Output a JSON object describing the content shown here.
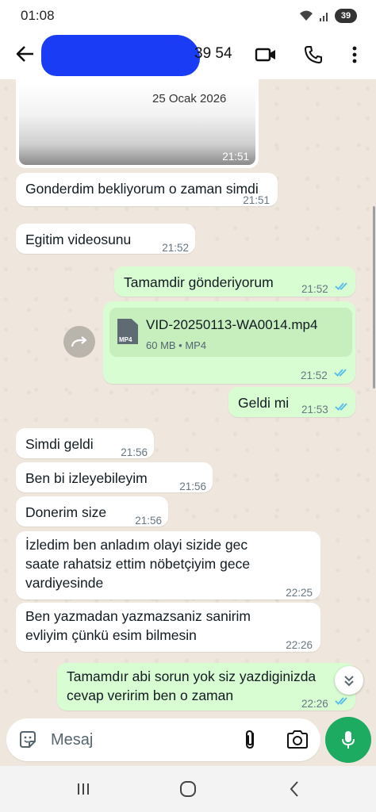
{
  "status_bar": {
    "time": "01:08",
    "battery": "39"
  },
  "header": {
    "contact_name_visible": "39 54"
  },
  "messages": [
    {
      "text": "Gonderdim bekliyorum o zaman simdi",
      "time": "21:51"
    },
    {
      "text": "Egitim videosunu",
      "time": "21:52"
    },
    {
      "text": "Tamamdir gönderiyorum",
      "time": "21:52"
    },
    {
      "time": "21:52"
    },
    {
      "text": "Geldi mi",
      "time": "21:53"
    },
    {
      "text": "Simdi geldi",
      "time": "21:56"
    },
    {
      "text": "Ben bi izleyebileyim",
      "time": "21:56"
    },
    {
      "text": "Donerim size",
      "time": "21:56"
    },
    {
      "line1": "İzledim ben anladım olayi sizide gec",
      "line2": "saate rahatsiz ettim nöbetçiyim gece",
      "line3": "vardiyesinde",
      "time": "22:25"
    },
    {
      "line1": "Ben yazmadan yazmazsaniz sanirim",
      "line2": "evliyim çünkü esim bilmesin",
      "time": "22:26"
    },
    {
      "line1": "Tamamdır abi sorun yok siz yazdiginizda",
      "line2": "cevap veririm ben o zaman",
      "time": "22:26"
    }
  ],
  "image_message": {
    "date_in_image": "25 Ocak 2026",
    "time": "21:51"
  },
  "file": {
    "name": "VID-20250113-WA0014.mp4",
    "meta": "60 MB • MP4",
    "type_label": "MP4"
  },
  "composer": {
    "placeholder": "Mesaj"
  },
  "colors": {
    "incoming": "#ffffff",
    "outgoing": "#d9fdd3",
    "accent": "#1daa61",
    "read_ticks": "#53bdeb"
  },
  "icons": {
    "back": "arrow-left-icon",
    "video_call": "video-camera-icon",
    "voice_call": "phone-icon",
    "menu": "more-vertical-icon",
    "forward": "forward-icon",
    "file": "mp4-file-icon",
    "scroll_down": "chevron-double-down-icon",
    "sticker": "sticker-icon",
    "attach": "paperclip-icon",
    "camera": "camera-icon",
    "mic": "microphone-icon"
  }
}
